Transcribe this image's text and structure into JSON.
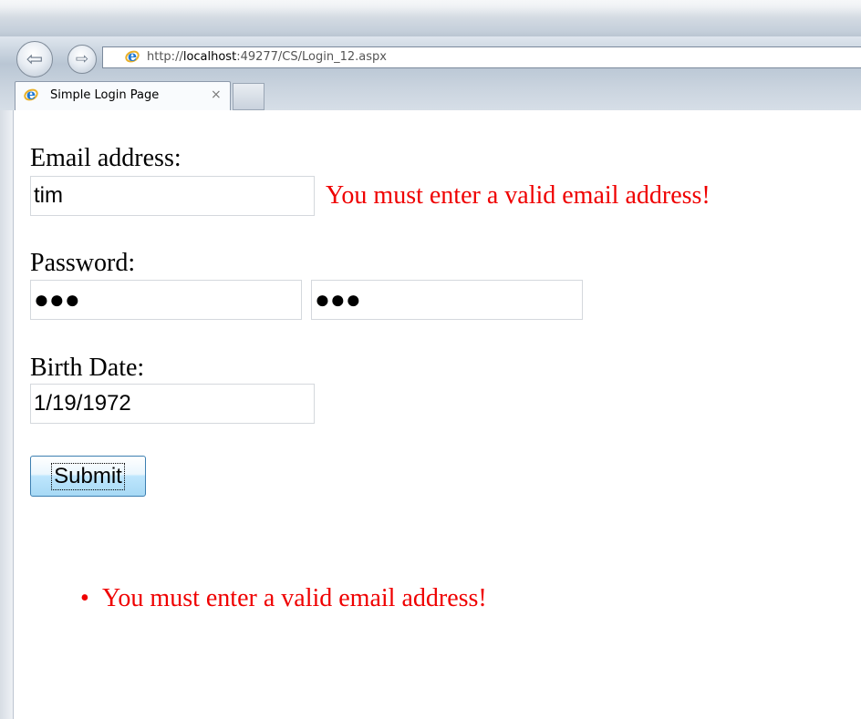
{
  "browser": {
    "url_prefix": "http://",
    "url_host": "localhost",
    "url_rest": ":49277/CS/Login_12.aspx",
    "tab_title": "Simple Login Page",
    "tab_close": "×"
  },
  "form": {
    "email_label": "Email address:",
    "email_value": "tim",
    "email_error": "You must enter a valid email address!",
    "password_label": "Password:",
    "password_value": "●●●",
    "password_confirm_value": "●●●",
    "birthdate_label": "Birth Date:",
    "birthdate_value": "1/19/1972",
    "submit_label": "Submit"
  },
  "validation_summary": {
    "bullet": "•",
    "items": [
      "You must enter a valid email address!"
    ]
  },
  "icons": {
    "back": "back-arrow-icon",
    "forward": "forward-arrow-icon",
    "browser": "internet-explorer-icon",
    "close": "close-icon"
  },
  "colors": {
    "error": "#ef0000",
    "ie_blue": "#1e78d3"
  }
}
